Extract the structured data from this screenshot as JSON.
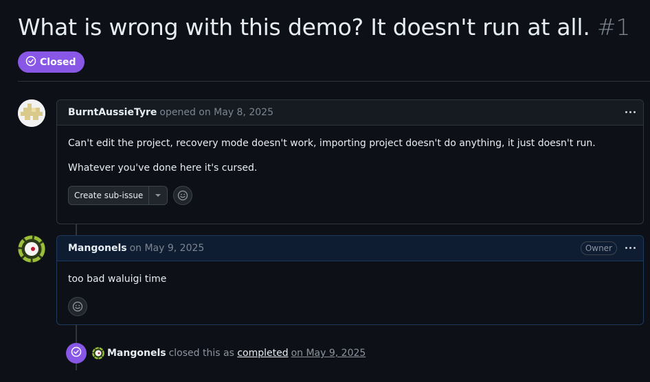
{
  "issue": {
    "title": "What is wrong with this demo? It doesn't run at all.",
    "number": "#1",
    "state": "Closed"
  },
  "comments": [
    {
      "author": "BurntAussieTyre",
      "meta": "opened on May 8, 2025",
      "body": [
        "Can't edit the project, recovery mode doesn't work, importing project doesn't do anything, it just doesn't run.",
        "Whatever you've done here it's cursed."
      ],
      "primary_action": "Create sub-issue"
    },
    {
      "author": "Mangonels",
      "meta": "on May 9, 2025",
      "role_badge": "Owner",
      "body": [
        "too bad waluigi time"
      ]
    }
  ],
  "event": {
    "actor": "Mangonels",
    "text": "closed this as",
    "reason": "completed",
    "date": "on May 9, 2025"
  },
  "colors": {
    "background": "#0d1117",
    "closed_purple": "#8957e5",
    "border": "#30363d",
    "muted_text": "#7d8590"
  },
  "icons": {
    "state": "check-circle-icon",
    "menu": "kebab-horizontal-icon",
    "dropdown": "triangle-down-icon",
    "reaction": "smiley-icon"
  }
}
